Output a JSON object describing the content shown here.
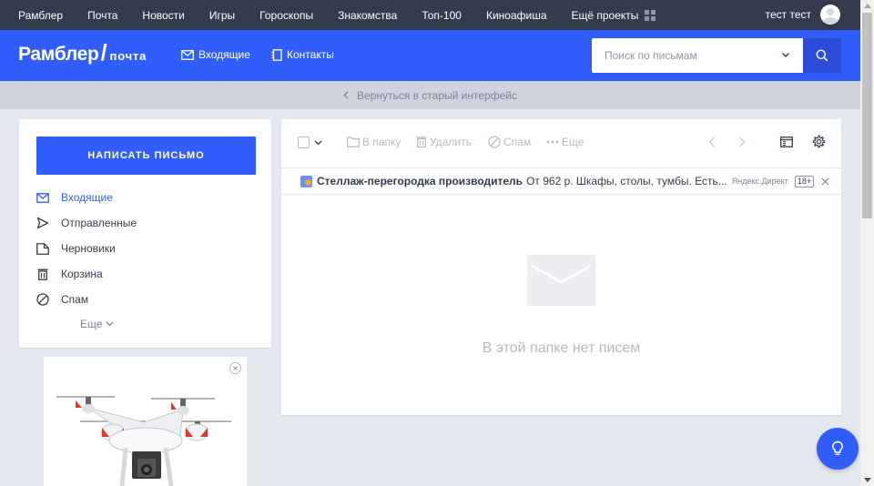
{
  "topbar": {
    "links": [
      "Рамблер",
      "Почта",
      "Новости",
      "Игры",
      "Гороскопы",
      "Знакомства",
      "Топ-100",
      "Киноафиша",
      "Ещё проекты"
    ],
    "user_name": "тест тест"
  },
  "header": {
    "logo_brand": "Рамблер",
    "logo_slash": "/",
    "logo_service": "почта",
    "inbox_label": "Входящие",
    "contacts_label": "Контакты",
    "search_placeholder": "Поиск по письмам"
  },
  "return_bar": {
    "label": "Вернуться в старый интерфейс"
  },
  "sidebar": {
    "compose_label": "НАПИСАТЬ ПИСЬМО",
    "folders": [
      {
        "label": "Входящие",
        "icon": "envelope-icon",
        "active": true
      },
      {
        "label": "Отправленные",
        "icon": "send-icon",
        "active": false
      },
      {
        "label": "Черновики",
        "icon": "draft-icon",
        "active": false
      },
      {
        "label": "Корзина",
        "icon": "trash-icon",
        "active": false
      },
      {
        "label": "Спам",
        "icon": "spam-icon",
        "active": false
      }
    ],
    "more_label": "Еще"
  },
  "toolbar": {
    "to_folder": "В папку",
    "delete": "Удалить",
    "spam": "Спам",
    "more": "Еще"
  },
  "ad_row": {
    "title": "Стеллаж-перегородка производитель",
    "text": "От 962 р. Шкафы, столы, тумбы. Есть...",
    "source": "Яндекс.Директ",
    "age": "18+"
  },
  "main": {
    "empty_text": "В этой папке нет писем"
  },
  "colors": {
    "accent": "#315efb",
    "topbar": "#343b4c",
    "background": "#e4e8ef"
  }
}
